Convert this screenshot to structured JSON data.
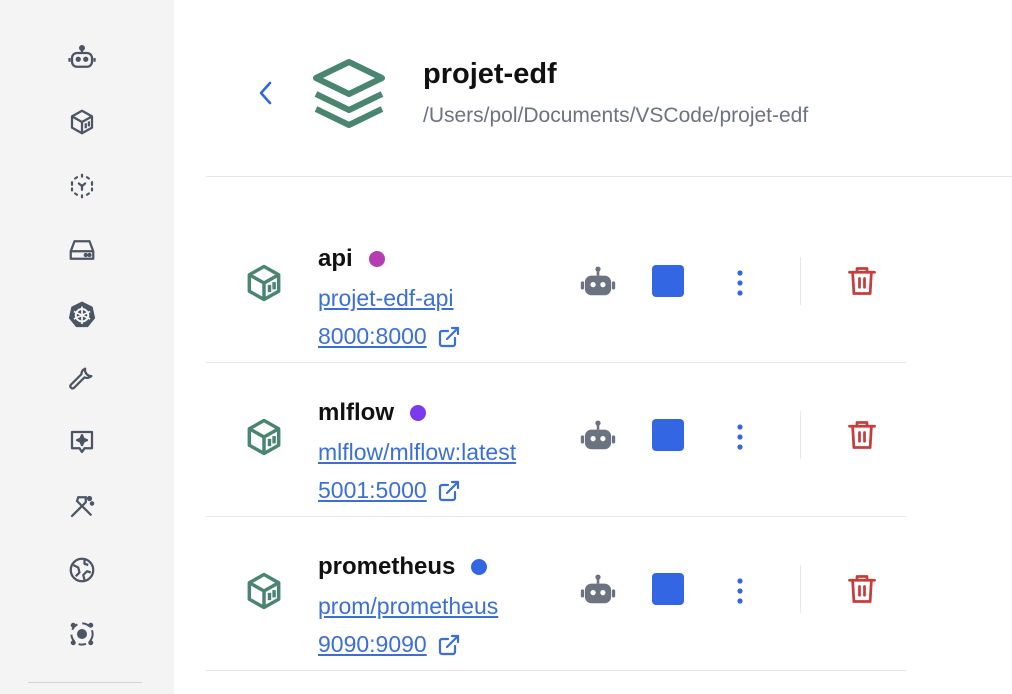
{
  "sidebar": {
    "items": [
      {
        "icon": "robot-icon"
      },
      {
        "icon": "container-box-icon"
      },
      {
        "icon": "pod-icon"
      },
      {
        "icon": "hard-drive-icon"
      },
      {
        "icon": "kubernetes-icon"
      },
      {
        "icon": "wrench-icon"
      },
      {
        "icon": "ai-sparkle-icon"
      },
      {
        "icon": "build-tools-icon"
      },
      {
        "icon": "globe-icon"
      },
      {
        "icon": "extension-icon"
      }
    ]
  },
  "project": {
    "name": "projet-edf",
    "path": "/Users/pol/Documents/VSCode/projet-edf"
  },
  "colors": {
    "accent": "#3266e3",
    "link": "#3b6fd8",
    "container_icon": "#4a8570",
    "delete": "#c93c3c",
    "sidebar_bg": "#f4f4f5"
  },
  "containers": [
    {
      "name": "api",
      "status_color": "#b43db4",
      "image": "projet-edf-api",
      "ports": "8000:8000"
    },
    {
      "name": "mlflow",
      "status_color": "#7c3aed",
      "image": "mlflow/mlflow:latest",
      "ports": "5001:5000"
    },
    {
      "name": "prometheus",
      "status_color": "#3266e3",
      "image": "prom/prometheus",
      "ports": "9090:9090"
    }
  ]
}
